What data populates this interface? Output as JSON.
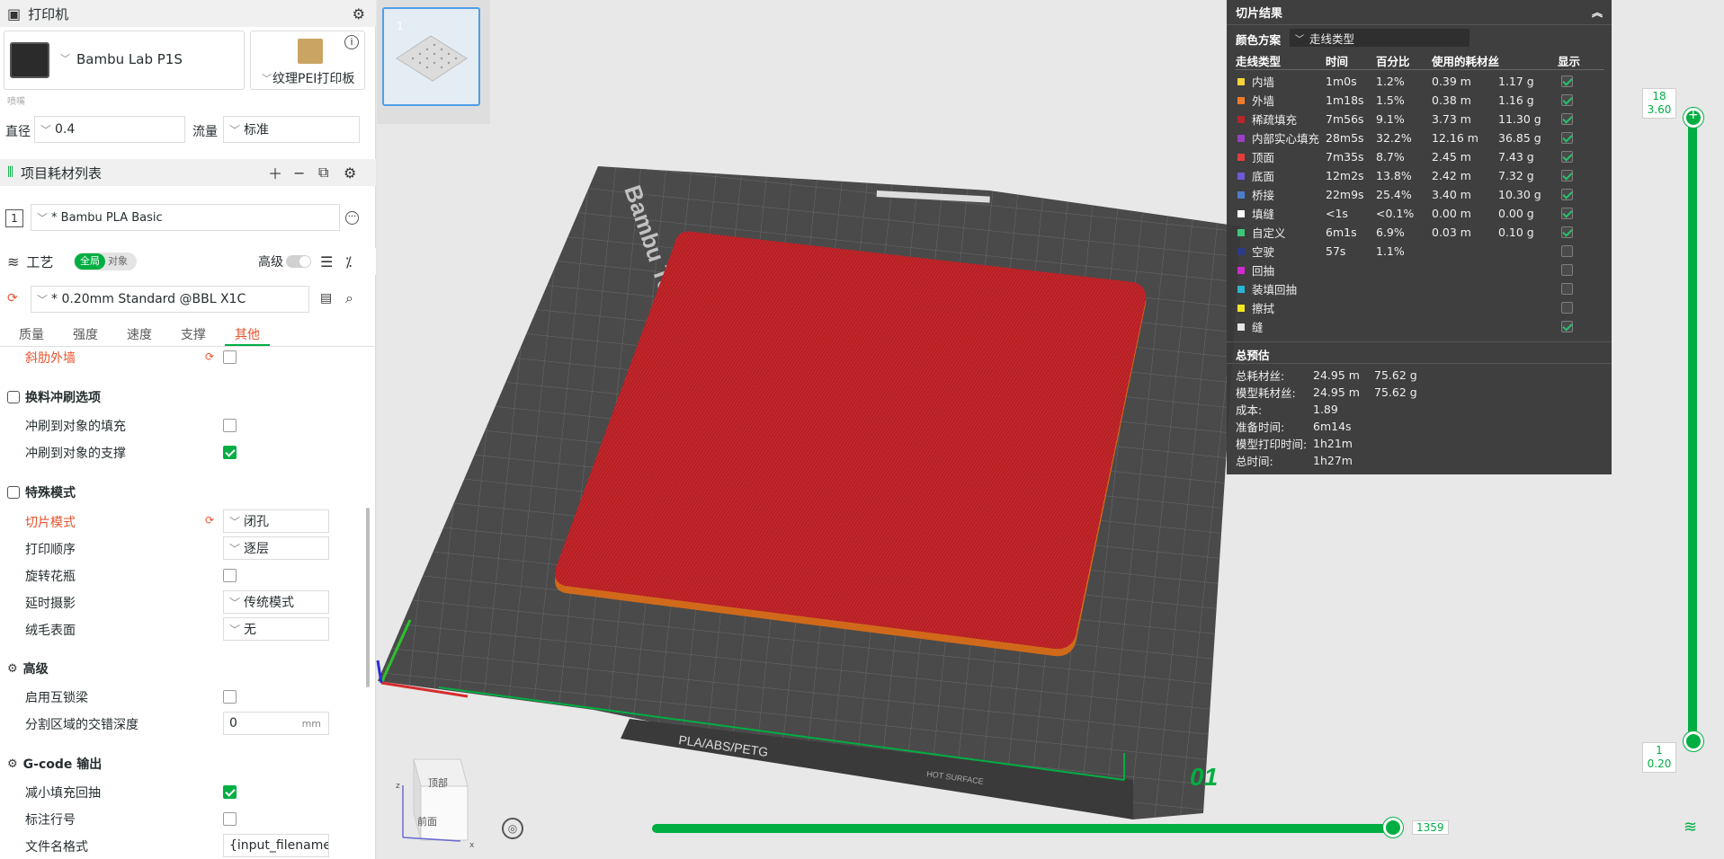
{
  "printer": {
    "title": "打印机",
    "model": "Bambu Lab P1S",
    "plate": "纹理PEI打印板",
    "nozzle_label": "喷嘴",
    "diameter_label": "直径",
    "diameter_value": "0.4",
    "flow_label": "流量",
    "flow_value": "标准"
  },
  "filament": {
    "title": "项目耗材列表",
    "index": "1",
    "name": "* Bambu PLA Basic"
  },
  "process": {
    "title": "工艺",
    "toggle_global": "全局",
    "toggle_object": "对象",
    "advanced_label": "高级",
    "preset": "* 0.20mm Standard @BBL X1C"
  },
  "tabs": [
    {
      "label": "质量"
    },
    {
      "label": "强度"
    },
    {
      "label": "速度"
    },
    {
      "label": "支撑"
    },
    {
      "label": "其他"
    }
  ],
  "settings": {
    "fuzzy_wall": "斜肋外墙",
    "flush_group": "换料冲刷选项",
    "flush_infill": "冲刷到对象的填充",
    "flush_support": "冲刷到对象的支撑",
    "special_group": "特殊模式",
    "slice_mode_label": "切片模式",
    "slice_mode_value": "闭孔",
    "print_seq_label": "打印顺序",
    "print_seq_value": "逐层",
    "spiral_label": "旋转花瓶",
    "timelapse_label": "延时摄影",
    "timelapse_value": "传统模式",
    "fuzzy_label": "绒毛表面",
    "fuzzy_value": "无",
    "adv_group": "高级",
    "interlock_label": "启用互锁梁",
    "interlock_depth_label": "分割区域的交错深度",
    "interlock_depth_value": "0",
    "interlock_depth_unit": "mm",
    "gcode_group": "G-code 输出",
    "reduce_retract_label": "减小填充回抽",
    "line_num_label": "标注行号",
    "filename_label": "文件名格式",
    "filename_value": "{input_filename_"
  },
  "thumb_number": "1",
  "bed_text": {
    "brand": "Bambu Textured PEI Plate",
    "bottom": "PLA/ABS/PETG",
    "hot": "HOT SURFACE",
    "plate_no": "01"
  },
  "cube": {
    "top": "顶部",
    "front": "前面",
    "x": "x",
    "z": "z"
  },
  "results": {
    "title": "切片结果",
    "scheme_label": "颜色方案",
    "scheme_value": "走线类型",
    "cols": [
      "走线类型",
      "时间",
      "百分比",
      "使用的耗材丝",
      "显示"
    ],
    "rows": [
      {
        "name": "内墙",
        "time": "1m0s",
        "pct": "1.2%",
        "len": "0.39 m",
        "wt": "1.17 g",
        "color": "#f5d43b",
        "show": true
      },
      {
        "name": "外墙",
        "time": "1m18s",
        "pct": "1.5%",
        "len": "0.38 m",
        "wt": "1.16 g",
        "color": "#f07c2a",
        "show": true
      },
      {
        "name": "稀疏填充",
        "time": "7m56s",
        "pct": "9.1%",
        "len": "3.73 m",
        "wt": "11.30 g",
        "color": "#b6262b",
        "show": true
      },
      {
        "name": "内部实心填充",
        "time": "28m5s",
        "pct": "32.2%",
        "len": "12.16 m",
        "wt": "36.85 g",
        "color": "#9a3fc5",
        "show": true
      },
      {
        "name": "顶面",
        "time": "7m35s",
        "pct": "8.7%",
        "len": "2.45 m",
        "wt": "7.43 g",
        "color": "#e33c3c",
        "show": true
      },
      {
        "name": "底面",
        "time": "12m2s",
        "pct": "13.8%",
        "len": "2.42 m",
        "wt": "7.32 g",
        "color": "#6b5bd8",
        "show": true
      },
      {
        "name": "桥接",
        "time": "22m9s",
        "pct": "25.4%",
        "len": "3.40 m",
        "wt": "10.30 g",
        "color": "#4d7dc9",
        "show": true
      },
      {
        "name": "填缝",
        "time": "<1s",
        "pct": "<0.1%",
        "len": "0.00 m",
        "wt": "0.00 g",
        "color": "#ffffff",
        "show": true
      },
      {
        "name": "自定义",
        "time": "6m1s",
        "pct": "6.9%",
        "len": "0.03 m",
        "wt": "0.10 g",
        "color": "#3ec67a",
        "show": true
      },
      {
        "name": "空驶",
        "time": "57s",
        "pct": "1.1%",
        "len": "",
        "wt": "",
        "color": "#2a3a8c",
        "show": false
      },
      {
        "name": "回抽",
        "time": "",
        "pct": "",
        "len": "",
        "wt": "",
        "color": "#d12ad1",
        "show": false
      },
      {
        "name": "装填回抽",
        "time": "",
        "pct": "",
        "len": "",
        "wt": "",
        "color": "#2ab6d1",
        "show": false
      },
      {
        "name": "擦拭",
        "time": "",
        "pct": "",
        "len": "",
        "wt": "",
        "color": "#f2e629",
        "show": false
      },
      {
        "name": "缝",
        "time": "",
        "pct": "",
        "len": "",
        "wt": "",
        "color": "#e6e6e6",
        "show": true
      }
    ],
    "summary_title": "总预估",
    "summary": [
      {
        "label": "总耗材丝:",
        "v1": "24.95 m",
        "v2": "75.62 g"
      },
      {
        "label": "模型耗材丝:",
        "v1": "24.95 m",
        "v2": "75.62 g"
      },
      {
        "label": "成本:",
        "v1": "1.89",
        "v2": ""
      },
      {
        "label": "准备时间:",
        "v1": "6m14s",
        "v2": ""
      },
      {
        "label": "模型打印时间:",
        "v1": "1h21m",
        "v2": ""
      },
      {
        "label": "总时间:",
        "v1": "1h27m",
        "v2": ""
      }
    ]
  },
  "layer_slider": {
    "top_layer": "18",
    "top_height": "3.60",
    "bottom_layer": "1",
    "bottom_height": "0.20"
  },
  "move_slider": {
    "value": "1359"
  }
}
